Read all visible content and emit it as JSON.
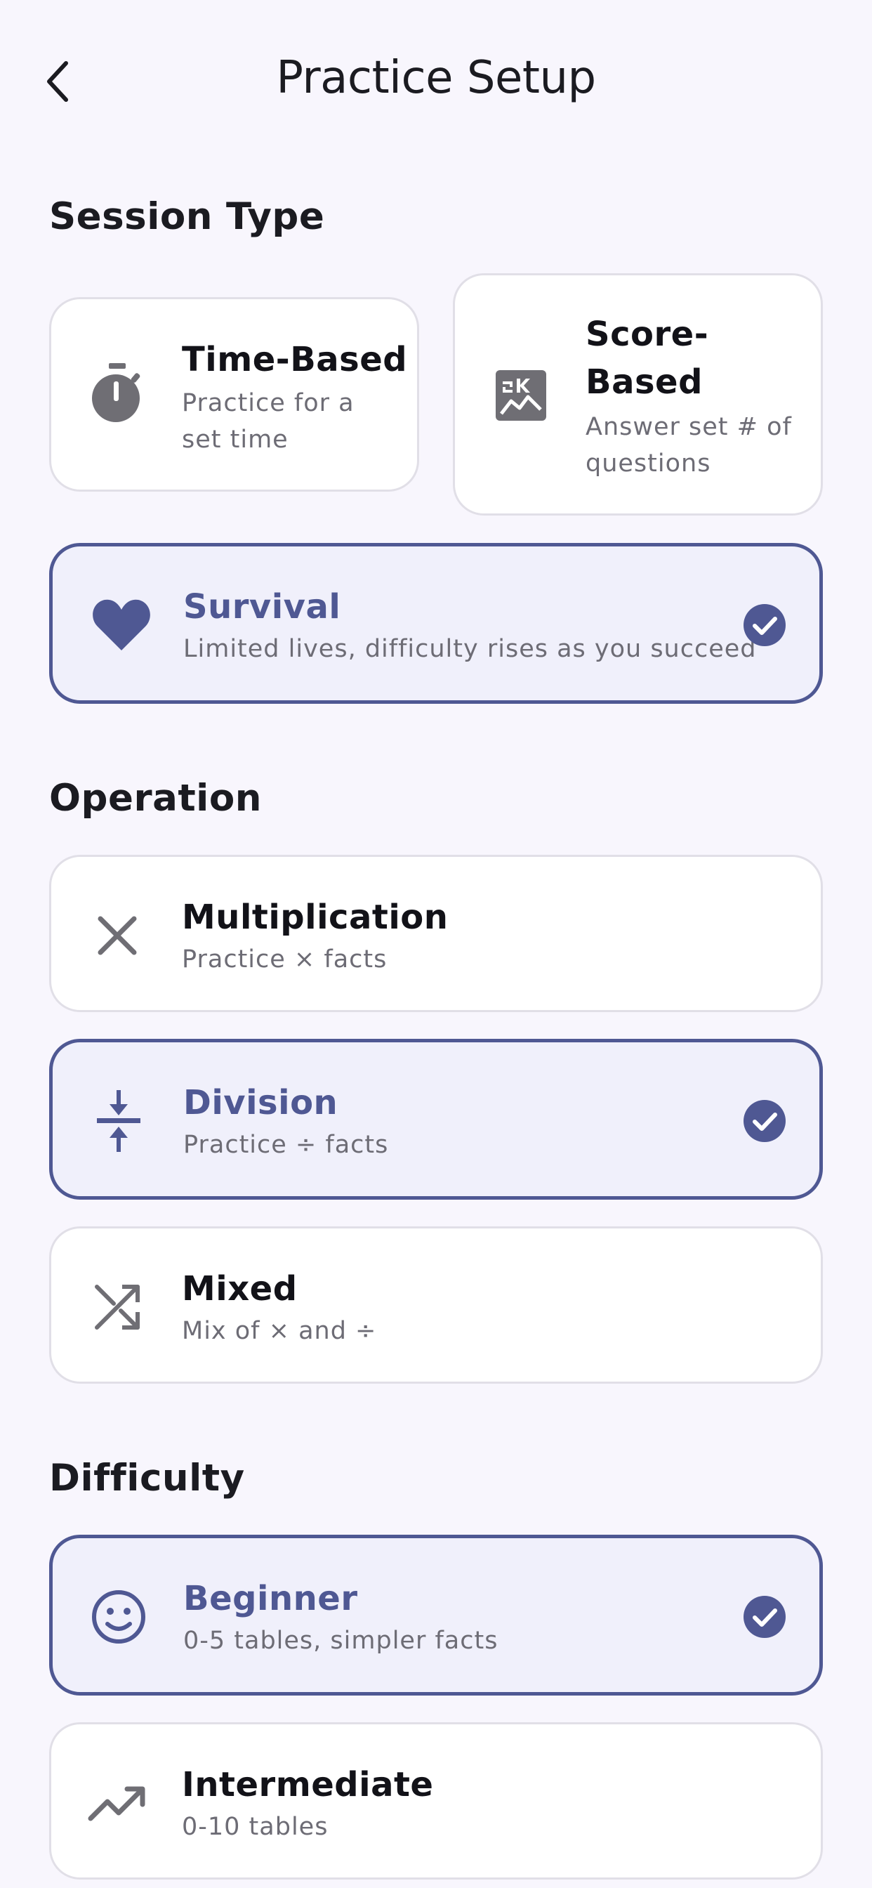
{
  "header": {
    "title": "Practice Setup"
  },
  "sections": {
    "session_type": "Session Type",
    "operation": "Operation",
    "difficulty": "Difficulty"
  },
  "session_types": {
    "time_based": {
      "title": "Time-Based",
      "desc": "Practice for a set time",
      "icon": "timer-icon",
      "selected": false
    },
    "score_based": {
      "title": "Score-Based",
      "desc": "Answer set # of questions",
      "icon": "scoreboard-icon",
      "selected": false
    },
    "survival": {
      "title": "Survival",
      "desc": "Limited lives, difficulty rises as you succeed",
      "icon": "heart-icon",
      "selected": true
    }
  },
  "operations": {
    "multiplication": {
      "title": "Multiplication",
      "desc": "Practice × facts",
      "icon": "multiply-icon",
      "selected": false
    },
    "division": {
      "title": "Division",
      "desc": "Practice ÷ facts",
      "icon": "divide-icon",
      "selected": true
    },
    "mixed": {
      "title": "Mixed",
      "desc": "Mix of × and ÷",
      "icon": "shuffle-icon",
      "selected": false
    }
  },
  "difficulties": {
    "beginner": {
      "title": "Beginner",
      "desc": "0-5 tables, simpler facts",
      "icon": "smiley-icon",
      "selected": true
    },
    "intermediate": {
      "title": "Intermediate",
      "desc": "0-10 tables",
      "icon": "trending-up-icon",
      "selected": false
    }
  },
  "colors": {
    "accent": "#4f5893",
    "selected_bg": "#f0f0fb",
    "icon_gray": "#6f6e74",
    "page_bg": "#f8f6fd"
  }
}
